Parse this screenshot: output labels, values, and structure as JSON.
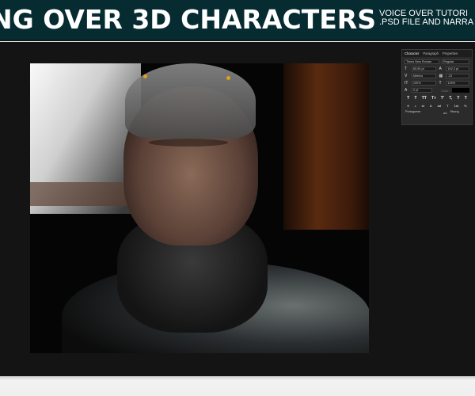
{
  "banner": {
    "title": "NG OVER 3D CHARACTERS",
    "subtitle_line1": "VOICE OVER TUTORI",
    "subtitle_line2": ".PSD FILE AND NARRA"
  },
  "panel": {
    "tabs": [
      "Character",
      "Paragraph",
      "Properties"
    ],
    "font_family": "Times New Roman",
    "font_style": "Regular",
    "font_size": "65,95 pt",
    "leading": "162,3 pt",
    "kerning": "Metrics",
    "tracking": "-23",
    "vertical_scale": "100%",
    "horizontal_scale": "100%",
    "baseline_shift": "0 pt",
    "color_label": "Color:",
    "style_buttons": [
      "T",
      "T",
      "TT",
      "Tт",
      "T'",
      "T,",
      "T",
      "T"
    ],
    "opentype_buttons": [
      "fi",
      "ℴ",
      "st",
      "A",
      "ad",
      "T",
      "1st",
      "½"
    ],
    "language": "Portuguese",
    "aa_label": "aa",
    "antialias": "Strong"
  }
}
